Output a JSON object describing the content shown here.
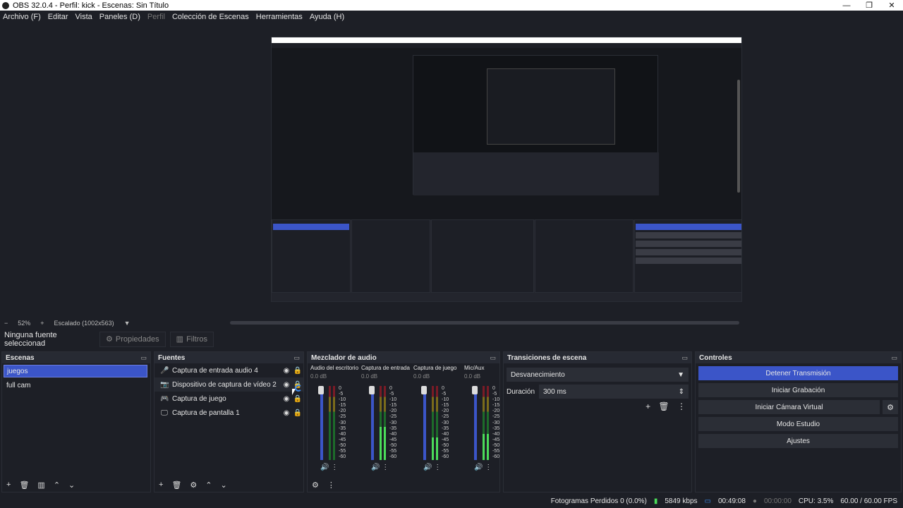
{
  "window": {
    "title": "OBS 32.0.4 - Perfil: kick - Escenas: Sin Título",
    "controls": [
      "—",
      "❐",
      "✕"
    ]
  },
  "menu": [
    {
      "label": "Archivo (F)",
      "disabled": false
    },
    {
      "label": "Editar",
      "disabled": false
    },
    {
      "label": "Vista",
      "disabled": false
    },
    {
      "label": "Paneles (D)",
      "disabled": false
    },
    {
      "label": "Perfil",
      "disabled": true
    },
    {
      "label": "Colección de Escenas",
      "disabled": false
    },
    {
      "label": "Herramientas",
      "disabled": false
    },
    {
      "label": "Ayuda (H)",
      "disabled": false
    }
  ],
  "zoom": {
    "minus": "−",
    "value": "52%",
    "plus": "+",
    "mode": "Escalado (1002x563)",
    "arrow": "▼"
  },
  "props": {
    "no_selection": "Ninguna fuente seleccionad",
    "properties": "Propiedades",
    "filters": "Filtros"
  },
  "scenes": {
    "title": "Escenas",
    "items": [
      "juegos",
      "full cam"
    ],
    "tools": [
      "+",
      "🗑",
      "▥",
      "⌃",
      "⌄"
    ]
  },
  "sources": {
    "title": "Fuentes",
    "items": [
      {
        "label": "Captura de entrada audio 4",
        "icon": "mic-icon",
        "glyph": "🎤"
      },
      {
        "label": "Dispositivo de captura de vídeo 2",
        "icon": "camera-icon",
        "glyph": "📷"
      },
      {
        "label": "Captura de juego",
        "icon": "gamepad-icon",
        "glyph": "🎮"
      },
      {
        "label": "Captura de pantalla 1",
        "icon": "monitor-icon",
        "glyph": "🖵"
      }
    ],
    "tools": [
      "+",
      "🗑",
      "⚙",
      "⌃",
      "⌄"
    ]
  },
  "mixer": {
    "title": "Mezclador de audio",
    "ticks": [
      "0",
      "-5",
      "-10",
      "-15",
      "-20",
      "-25",
      "-30",
      "-35",
      "-40",
      "-45",
      "-50",
      "-55",
      "-60"
    ],
    "channels": [
      {
        "name": "Audio del escritorio",
        "db": "0.0 dB",
        "level": 0.0
      },
      {
        "name": "Captura de entrada",
        "db": "0.0 dB",
        "level": 0.45
      },
      {
        "name": "Captura de juego",
        "db": "0.0 dB",
        "level": 0.3
      },
      {
        "name": "Mic/Aux",
        "db": "0.0 dB",
        "level": 0.35
      }
    ]
  },
  "transitions": {
    "title": "Transiciones de escena",
    "selected": "Desvanecimiento",
    "duration_label": "Duración",
    "duration_value": "300 ms"
  },
  "controls": {
    "title": "Controles",
    "stop_stream": "Detener Transmisión",
    "start_recording": "Iniciar Grabación",
    "start_virtualcam": "Iniciar Cámara Virtual",
    "studio_mode": "Modo Estudio",
    "settings": "Ajustes"
  },
  "status": {
    "dropped": "Fotogramas Perdidos 0 (0.0%)",
    "bitrate": "5849 kbps",
    "stream_time": "00:49:08",
    "rec_time": "00:00:00",
    "cpu": "CPU: 3.5%",
    "fps": "60.00 / 60.00 FPS"
  },
  "colors": {
    "accent": "#3b55c8",
    "background": "#1d1f26",
    "panel_header": "#272a33"
  }
}
